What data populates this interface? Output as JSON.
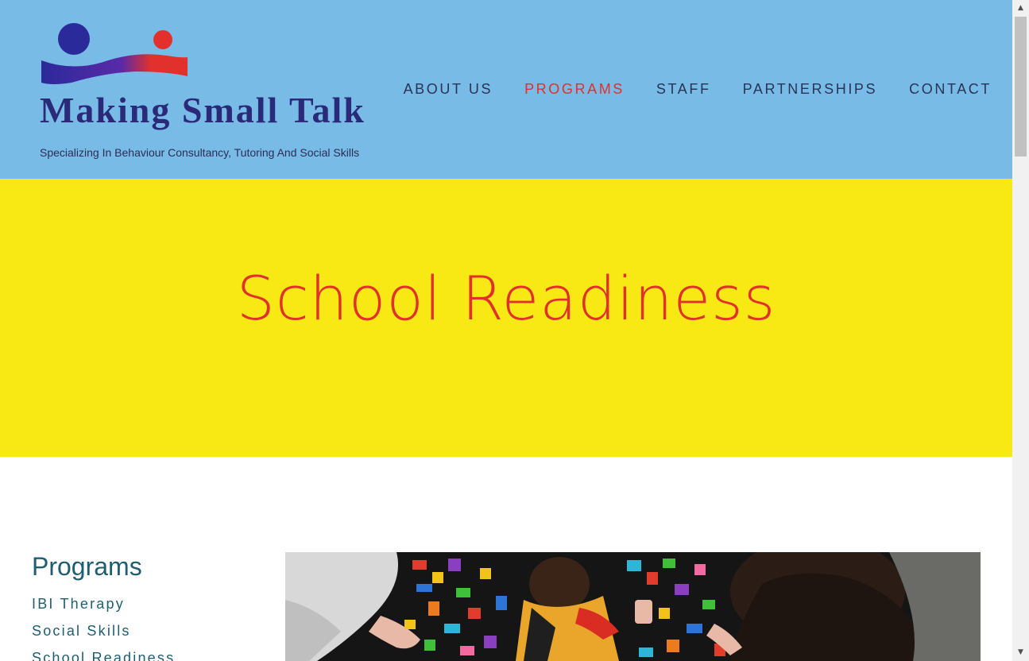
{
  "brand": {
    "name": "Making Small Talk",
    "tagline": "Specializing In Behaviour Consultancy, Tutoring And Social Skills",
    "colors": {
      "blue": "#2a2a78",
      "red": "#e2302c",
      "header_bg": "#77bbe6",
      "hero_bg": "#f8e814"
    }
  },
  "nav": {
    "items": [
      {
        "label": "ABOUT US",
        "active": false
      },
      {
        "label": "PROGRAMS",
        "active": true
      },
      {
        "label": "STAFF",
        "active": false
      },
      {
        "label": "PARTNERSHIPS",
        "active": false
      },
      {
        "label": "CONTACT",
        "active": false
      }
    ]
  },
  "hero": {
    "title": "School Readiness"
  },
  "sidebar": {
    "title": "Programs",
    "items": [
      {
        "label": "IBI Therapy"
      },
      {
        "label": "Social Skills"
      },
      {
        "label": "School Readiness"
      }
    ]
  },
  "icons": {
    "scroll_up": "chevron-up-icon",
    "scroll_down": "chevron-down-icon"
  }
}
